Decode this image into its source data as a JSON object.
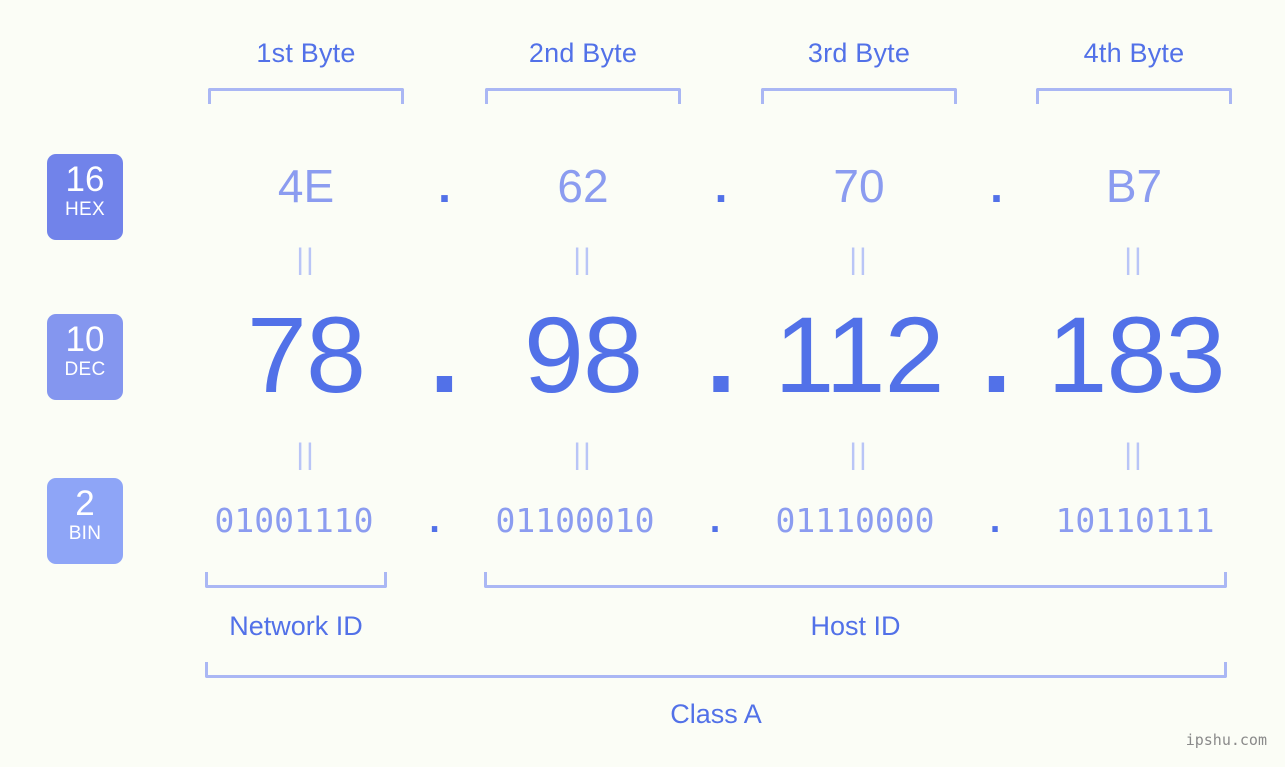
{
  "background_color": "#fbfdf6",
  "accent_color": "#5271e8",
  "muted_accent_color": "#8b9cf0",
  "bracket_color": "#aab7f4",
  "byte_headers": [
    {
      "label": "1st Byte"
    },
    {
      "label": "2nd Byte"
    },
    {
      "label": "3rd Byte"
    },
    {
      "label": "4th Byte"
    }
  ],
  "rows": {
    "hex": {
      "badge_base": "16",
      "badge_name": "HEX",
      "badge_color": "#7183ea",
      "values": [
        "4E",
        "62",
        "70",
        "B7"
      ],
      "separator": "."
    },
    "dec": {
      "badge_base": "10",
      "badge_name": "DEC",
      "badge_color": "#8496ef",
      "values": [
        "78",
        "98",
        "112",
        "183"
      ],
      "separator": "."
    },
    "bin": {
      "badge_base": "2",
      "badge_name": "BIN",
      "badge_color": "#8ea5f7",
      "values": [
        "01001110",
        "01100010",
        "01110000",
        "10110111"
      ],
      "separator": "."
    }
  },
  "equals_symbol": "||",
  "segments": {
    "network_id": "Network ID",
    "host_id": "Host ID"
  },
  "class_label": "Class A",
  "watermark": "ipshu.com"
}
